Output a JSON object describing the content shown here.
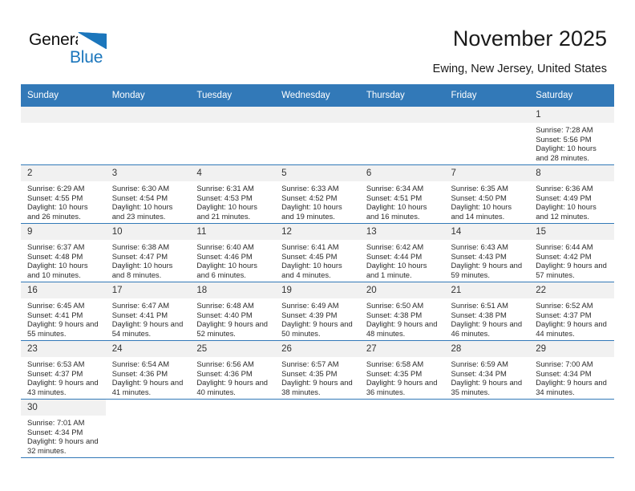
{
  "brand": {
    "name_top": "General",
    "name_bottom": "Blue",
    "accent_color": "#1B76BC"
  },
  "header": {
    "title": "November 2025",
    "location": "Ewing, New Jersey, United States"
  },
  "theme": {
    "header_blue": "#3279B8",
    "daynum_band": "#F1F1F1",
    "grid_line": "#3279B8"
  },
  "weekday_headers": [
    "Sunday",
    "Monday",
    "Tuesday",
    "Wednesday",
    "Thursday",
    "Friday",
    "Saturday"
  ],
  "labels": {
    "sunrise_prefix": "Sunrise:",
    "sunset_prefix": "Sunset:",
    "daylight_prefix": "Daylight:"
  },
  "weeks": [
    [
      {
        "day": "",
        "empty": true
      },
      {
        "day": "",
        "empty": true
      },
      {
        "day": "",
        "empty": true
      },
      {
        "day": "",
        "empty": true
      },
      {
        "day": "",
        "empty": true
      },
      {
        "day": "",
        "empty": true
      },
      {
        "day": "1",
        "sunrise": "Sunrise: 7:28 AM",
        "sunset": "Sunset: 5:56 PM",
        "daylight": "Daylight: 10 hours and 28 minutes."
      }
    ],
    [
      {
        "day": "2",
        "sunrise": "Sunrise: 6:29 AM",
        "sunset": "Sunset: 4:55 PM",
        "daylight": "Daylight: 10 hours and 26 minutes."
      },
      {
        "day": "3",
        "sunrise": "Sunrise: 6:30 AM",
        "sunset": "Sunset: 4:54 PM",
        "daylight": "Daylight: 10 hours and 23 minutes."
      },
      {
        "day": "4",
        "sunrise": "Sunrise: 6:31 AM",
        "sunset": "Sunset: 4:53 PM",
        "daylight": "Daylight: 10 hours and 21 minutes."
      },
      {
        "day": "5",
        "sunrise": "Sunrise: 6:33 AM",
        "sunset": "Sunset: 4:52 PM",
        "daylight": "Daylight: 10 hours and 19 minutes."
      },
      {
        "day": "6",
        "sunrise": "Sunrise: 6:34 AM",
        "sunset": "Sunset: 4:51 PM",
        "daylight": "Daylight: 10 hours and 16 minutes."
      },
      {
        "day": "7",
        "sunrise": "Sunrise: 6:35 AM",
        "sunset": "Sunset: 4:50 PM",
        "daylight": "Daylight: 10 hours and 14 minutes."
      },
      {
        "day": "8",
        "sunrise": "Sunrise: 6:36 AM",
        "sunset": "Sunset: 4:49 PM",
        "daylight": "Daylight: 10 hours and 12 minutes."
      }
    ],
    [
      {
        "day": "9",
        "sunrise": "Sunrise: 6:37 AM",
        "sunset": "Sunset: 4:48 PM",
        "daylight": "Daylight: 10 hours and 10 minutes."
      },
      {
        "day": "10",
        "sunrise": "Sunrise: 6:38 AM",
        "sunset": "Sunset: 4:47 PM",
        "daylight": "Daylight: 10 hours and 8 minutes."
      },
      {
        "day": "11",
        "sunrise": "Sunrise: 6:40 AM",
        "sunset": "Sunset: 4:46 PM",
        "daylight": "Daylight: 10 hours and 6 minutes."
      },
      {
        "day": "12",
        "sunrise": "Sunrise: 6:41 AM",
        "sunset": "Sunset: 4:45 PM",
        "daylight": "Daylight: 10 hours and 4 minutes."
      },
      {
        "day": "13",
        "sunrise": "Sunrise: 6:42 AM",
        "sunset": "Sunset: 4:44 PM",
        "daylight": "Daylight: 10 hours and 1 minute."
      },
      {
        "day": "14",
        "sunrise": "Sunrise: 6:43 AM",
        "sunset": "Sunset: 4:43 PM",
        "daylight": "Daylight: 9 hours and 59 minutes."
      },
      {
        "day": "15",
        "sunrise": "Sunrise: 6:44 AM",
        "sunset": "Sunset: 4:42 PM",
        "daylight": "Daylight: 9 hours and 57 minutes."
      }
    ],
    [
      {
        "day": "16",
        "sunrise": "Sunrise: 6:45 AM",
        "sunset": "Sunset: 4:41 PM",
        "daylight": "Daylight: 9 hours and 55 minutes."
      },
      {
        "day": "17",
        "sunrise": "Sunrise: 6:47 AM",
        "sunset": "Sunset: 4:41 PM",
        "daylight": "Daylight: 9 hours and 54 minutes."
      },
      {
        "day": "18",
        "sunrise": "Sunrise: 6:48 AM",
        "sunset": "Sunset: 4:40 PM",
        "daylight": "Daylight: 9 hours and 52 minutes."
      },
      {
        "day": "19",
        "sunrise": "Sunrise: 6:49 AM",
        "sunset": "Sunset: 4:39 PM",
        "daylight": "Daylight: 9 hours and 50 minutes."
      },
      {
        "day": "20",
        "sunrise": "Sunrise: 6:50 AM",
        "sunset": "Sunset: 4:38 PM",
        "daylight": "Daylight: 9 hours and 48 minutes."
      },
      {
        "day": "21",
        "sunrise": "Sunrise: 6:51 AM",
        "sunset": "Sunset: 4:38 PM",
        "daylight": "Daylight: 9 hours and 46 minutes."
      },
      {
        "day": "22",
        "sunrise": "Sunrise: 6:52 AM",
        "sunset": "Sunset: 4:37 PM",
        "daylight": "Daylight: 9 hours and 44 minutes."
      }
    ],
    [
      {
        "day": "23",
        "sunrise": "Sunrise: 6:53 AM",
        "sunset": "Sunset: 4:37 PM",
        "daylight": "Daylight: 9 hours and 43 minutes."
      },
      {
        "day": "24",
        "sunrise": "Sunrise: 6:54 AM",
        "sunset": "Sunset: 4:36 PM",
        "daylight": "Daylight: 9 hours and 41 minutes."
      },
      {
        "day": "25",
        "sunrise": "Sunrise: 6:56 AM",
        "sunset": "Sunset: 4:36 PM",
        "daylight": "Daylight: 9 hours and 40 minutes."
      },
      {
        "day": "26",
        "sunrise": "Sunrise: 6:57 AM",
        "sunset": "Sunset: 4:35 PM",
        "daylight": "Daylight: 9 hours and 38 minutes."
      },
      {
        "day": "27",
        "sunrise": "Sunrise: 6:58 AM",
        "sunset": "Sunset: 4:35 PM",
        "daylight": "Daylight: 9 hours and 36 minutes."
      },
      {
        "day": "28",
        "sunrise": "Sunrise: 6:59 AM",
        "sunset": "Sunset: 4:34 PM",
        "daylight": "Daylight: 9 hours and 35 minutes."
      },
      {
        "day": "29",
        "sunrise": "Sunrise: 7:00 AM",
        "sunset": "Sunset: 4:34 PM",
        "daylight": "Daylight: 9 hours and 34 minutes."
      }
    ],
    [
      {
        "day": "30",
        "sunrise": "Sunrise: 7:01 AM",
        "sunset": "Sunset: 4:34 PM",
        "daylight": "Daylight: 9 hours and 32 minutes."
      },
      {
        "day": "",
        "blank": true
      },
      {
        "day": "",
        "blank": true
      },
      {
        "day": "",
        "blank": true
      },
      {
        "day": "",
        "blank": true
      },
      {
        "day": "",
        "blank": true
      },
      {
        "day": "",
        "blank": true
      }
    ]
  ]
}
